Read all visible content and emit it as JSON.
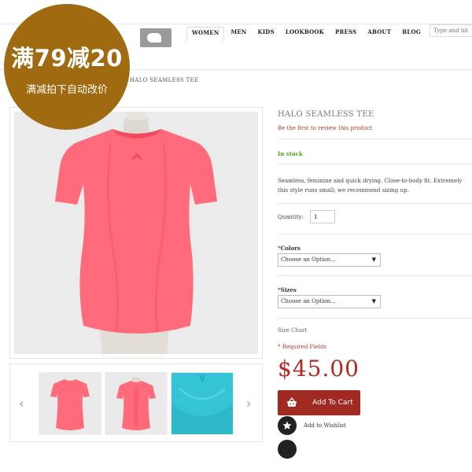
{
  "header": {
    "nav": [
      "WOMEN",
      "MEN",
      "KIDS",
      "LOOKBOOK",
      "PRESS",
      "ABOUT",
      "BLOG"
    ],
    "active_nav": "WOMEN",
    "search_placeholder": "Type and hit"
  },
  "breadcrumb": "HALO SEAMLESS TEE",
  "promo": {
    "headline": "满79减20",
    "subline": "满减拍下自动改价",
    "color": "#a06a10"
  },
  "product": {
    "title": "HALO SEAMLESS TEE",
    "review_link": "Be the first to review this product",
    "stock": "In stock",
    "description_lines": [
      "Seamless, feminine and quick drying. Close-to-body fit. Extremely",
      "this style runs small; we recommend sizing up."
    ],
    "quantity_label": "Quantity:",
    "quantity_value": "1",
    "colors_label": "Colors",
    "colors_select": "Choose an Option...",
    "sizes_label": "Sizes",
    "sizes_select": "Choose an Option...",
    "size_chart": "Size Chart",
    "required_fields": "* Required Fields",
    "price": "$45.00",
    "add_to_cart": "Add To Cart",
    "add_to_wishlist": "Add to Wishlist",
    "accent_color": "#a02a22"
  },
  "gallery": {
    "prev_icon": "chevron-left-icon",
    "next_icon": "chevron-right-icon",
    "thumbnails": [
      "pink-tee-front",
      "pink-tee-back",
      "turquoise-fabric-closeup"
    ]
  }
}
